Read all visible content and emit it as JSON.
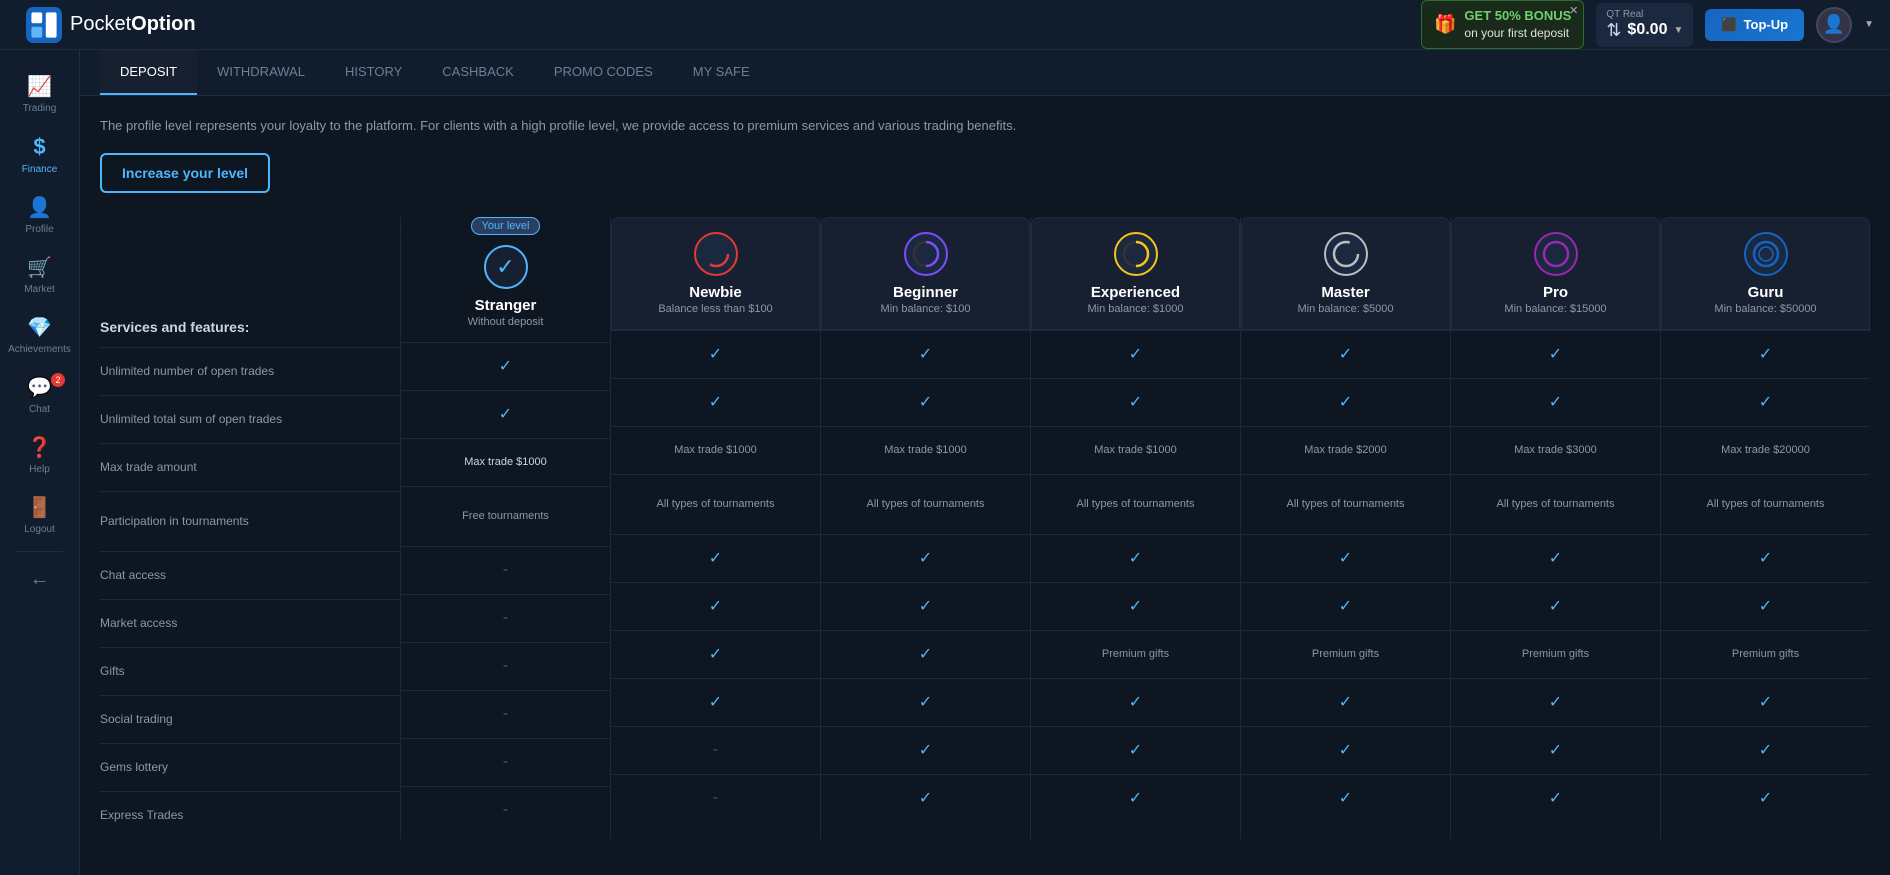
{
  "app": {
    "logo": "PocketOption",
    "logo_bold": "Option",
    "logo_regular": "Pocket"
  },
  "topbar": {
    "bonus_text": "GET 50% BONUS",
    "bonus_sub": "on your first deposit",
    "balance_label": "QT Real",
    "balance_amount": "$0.00",
    "topup_label": "Top-Up"
  },
  "sidebar": {
    "items": [
      {
        "id": "trading",
        "label": "Trading",
        "icon": "📈",
        "active": false
      },
      {
        "id": "finance",
        "label": "Finance",
        "icon": "$",
        "active": true
      },
      {
        "id": "profile",
        "label": "Profile",
        "icon": "👤",
        "active": false
      },
      {
        "id": "market",
        "label": "Market",
        "icon": "🛒",
        "active": false
      },
      {
        "id": "achievements",
        "label": "Achievements",
        "icon": "💎",
        "active": false
      },
      {
        "id": "chat",
        "label": "Chat",
        "icon": "💬",
        "active": false,
        "badge": "2"
      },
      {
        "id": "help",
        "label": "Help",
        "icon": "❓",
        "active": false
      },
      {
        "id": "logout",
        "label": "Logout",
        "icon": "🚪",
        "active": false
      }
    ]
  },
  "nav_tabs": {
    "tabs": [
      {
        "id": "deposit",
        "label": "DEPOSIT",
        "active": true
      },
      {
        "id": "withdrawal",
        "label": "WITHDRAWAL",
        "active": false
      },
      {
        "id": "history",
        "label": "HISTORY",
        "active": false
      },
      {
        "id": "cashback",
        "label": "CASHBACK",
        "active": false
      },
      {
        "id": "promo",
        "label": "PROMO CODES",
        "active": false
      },
      {
        "id": "mysafe",
        "label": "MY SAFE",
        "active": false
      }
    ]
  },
  "page": {
    "description": "The profile level represents your loyalty to the platform. For clients with a high profile level, we provide access to premium services and various trading benefits.",
    "increase_btn": "Increase your level",
    "features_title": "Services and features:",
    "features": [
      {
        "id": "open-trades",
        "label": "Unlimited number of open trades"
      },
      {
        "id": "total-sum",
        "label": "Unlimited total sum of open trades"
      },
      {
        "id": "max-trade",
        "label": "Max trade amount"
      },
      {
        "id": "tournaments",
        "label": "Participation in tournaments"
      },
      {
        "id": "chat",
        "label": "Chat access"
      },
      {
        "id": "market",
        "label": "Market access"
      },
      {
        "id": "gifts",
        "label": "Gifts"
      },
      {
        "id": "social",
        "label": "Social trading"
      },
      {
        "id": "gems",
        "label": "Gems lottery"
      },
      {
        "id": "express",
        "label": "Express Trades"
      }
    ],
    "levels": [
      {
        "id": "stranger",
        "name": "Stranger",
        "sub": "Without deposit",
        "badge": "Your level",
        "current": true,
        "avatar_char": "✓",
        "avatar_color": "#4db6ff",
        "cells": {
          "open_trades": "check",
          "total_sum": "check",
          "max_trade": "Max trade $1000",
          "tournaments": "Free tournaments",
          "chat": "-",
          "market": "-",
          "gifts": "-",
          "social": "-",
          "gems": "-",
          "express": "-"
        }
      },
      {
        "id": "newbie",
        "name": "Newbie",
        "sub": "Balance less than $100",
        "current": false,
        "avatar_char": "●",
        "avatar_color": "#e53935",
        "cells": {
          "open_trades": "check",
          "total_sum": "check",
          "max_trade": "Max trade $1000",
          "tournaments": "All types of tournaments",
          "chat": "check",
          "market": "check",
          "gifts": "check",
          "social": "check",
          "gems": "-",
          "express": "-"
        }
      },
      {
        "id": "beginner",
        "name": "Beginner",
        "sub": "Min balance: $100",
        "current": false,
        "avatar_char": "◐",
        "avatar_color": "#7c4dff",
        "cells": {
          "open_trades": "check",
          "total_sum": "check",
          "max_trade": "Max trade $1000",
          "tournaments": "All types of tournaments",
          "chat": "check",
          "market": "check",
          "gifts": "check",
          "social": "check",
          "gems": "check",
          "express": "check"
        }
      },
      {
        "id": "experienced",
        "name": "Experienced",
        "sub": "Min balance: $1000",
        "current": false,
        "avatar_char": "◑",
        "avatar_color": "#f5c518",
        "cells": {
          "open_trades": "check",
          "total_sum": "check",
          "max_trade": "Max trade $1000",
          "tournaments": "All types of tournaments",
          "chat": "check",
          "market": "check",
          "gifts": "Premium gifts",
          "social": "check",
          "gems": "check",
          "express": "check"
        }
      },
      {
        "id": "master",
        "name": "Master",
        "sub": "Min balance: $5000",
        "current": false,
        "avatar_char": "○",
        "avatar_color": "#bdbdbd",
        "cells": {
          "open_trades": "check",
          "total_sum": "check",
          "max_trade": "Max trade $2000",
          "tournaments": "All types of tournaments",
          "chat": "check",
          "market": "check",
          "gifts": "Premium gifts",
          "social": "check",
          "gems": "check",
          "express": "check"
        }
      },
      {
        "id": "pro",
        "name": "Pro",
        "sub": "Min balance: $15000",
        "current": false,
        "avatar_char": "◯",
        "avatar_color": "#9c27b0",
        "cells": {
          "open_trades": "check",
          "total_sum": "check",
          "max_trade": "Max trade $3000",
          "tournaments": "All types of tournaments",
          "chat": "check",
          "market": "check",
          "gifts": "Premium gifts",
          "social": "check",
          "gems": "check",
          "express": "check"
        }
      },
      {
        "id": "guru",
        "name": "Guru",
        "sub": "Min balance: $50000",
        "current": false,
        "avatar_char": "⬡",
        "avatar_color": "#1565c0",
        "cells": {
          "open_trades": "check",
          "total_sum": "check",
          "max_trade": "Max trade $20000",
          "tournaments": "All types of tournaments",
          "chat": "check",
          "market": "check",
          "gifts": "Premium gifts",
          "social": "check",
          "gems": "check",
          "express": "check"
        }
      }
    ]
  }
}
